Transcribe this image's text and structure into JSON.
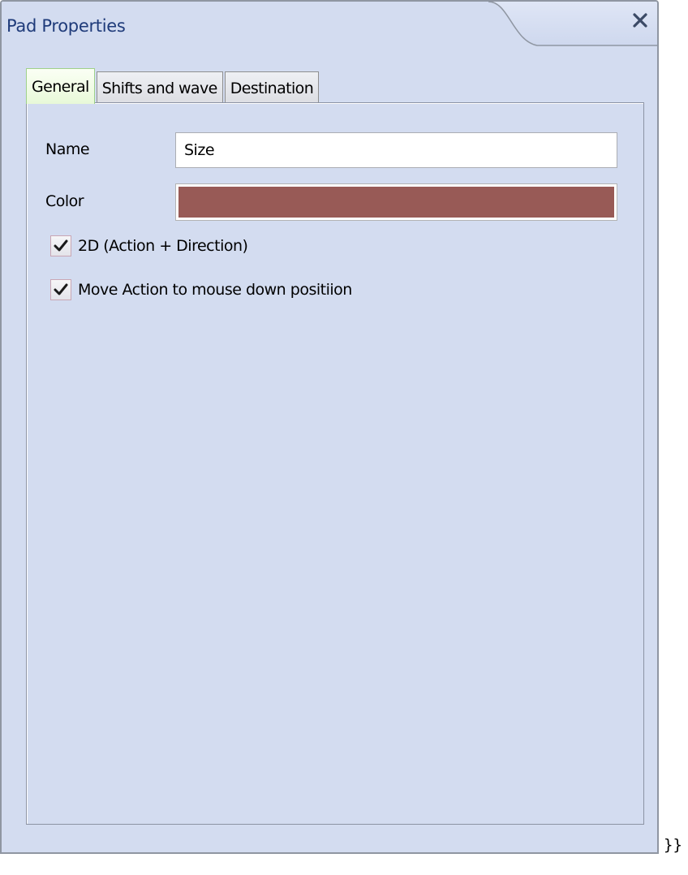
{
  "window": {
    "title": "Pad Properties",
    "close_icon": "close-icon"
  },
  "tabs": [
    {
      "label": "General",
      "active": true
    },
    {
      "label": "Shifts and wave",
      "active": false
    },
    {
      "label": "Destination",
      "active": false
    }
  ],
  "general": {
    "name_label": "Name",
    "name_value": "Size",
    "color_label": "Color",
    "color_value": "#985a56",
    "checkbox_2d": {
      "label": "2D (Action + Direction)",
      "checked": true
    },
    "checkbox_move": {
      "label": "Move Action to mouse down positiion",
      "checked": true
    }
  },
  "trailing_text": "}}",
  "colors": {
    "dialog_bg": "#d3dcf0",
    "title_text": "#1f3b7a",
    "active_tab": "#e8f9d8"
  }
}
